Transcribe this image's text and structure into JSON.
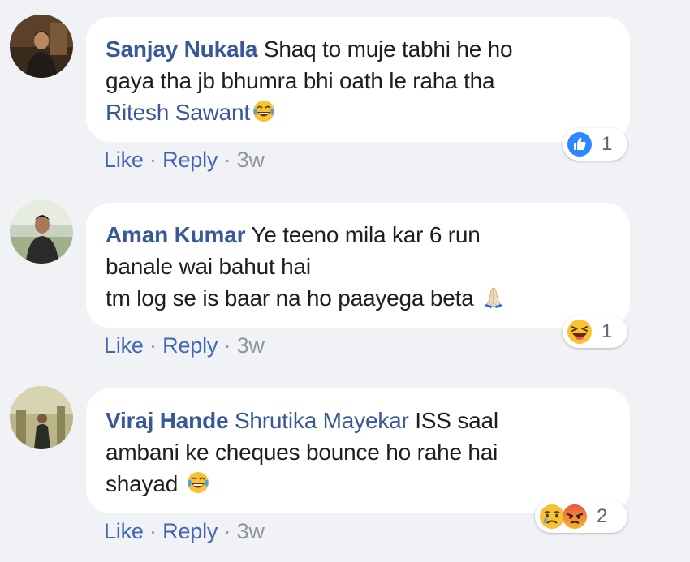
{
  "comments": [
    {
      "author": "Sanjay Nukala",
      "text_line1": " Shaq to muje tabhi he ho",
      "text_line2": "gaya tha jb bhumra bhi oath le raha tha",
      "tag": "Ritesh Sawant",
      "emoji": "tears-of-joy-emoji",
      "actions": {
        "like": "Like",
        "sep1": " · ",
        "reply": "Reply",
        "sep2": " · ",
        "time": "3w"
      },
      "reactions": {
        "icons": [
          "like-reaction-icon"
        ],
        "count": "1"
      }
    },
    {
      "author": "Aman Kumar",
      "text_line1": " Ye teeno mila kar 6 run",
      "text_line2": "banale wai bahut hai",
      "text_line3": "tm log se is baar na ho paayega beta ",
      "emoji": "folded-hands-emoji",
      "actions": {
        "like": "Like",
        "sep1": " · ",
        "reply": "Reply",
        "sep2": " · ",
        "time": "3w"
      },
      "reactions": {
        "icons": [
          "haha-reaction-icon"
        ],
        "count": "1"
      }
    },
    {
      "author": "Viraj Hande",
      "tag": "Shrutika Mayekar",
      "text_line1": " ISS saal",
      "text_line2": "ambani ke cheques bounce ho rahe hai",
      "text_line3": "shayad ",
      "emoji": "tears-of-joy-emoji",
      "actions": {
        "like": "Like",
        "sep1": " · ",
        "reply": "Reply",
        "sep2": " · ",
        "time": "3w"
      },
      "reactions": {
        "icons": [
          "sad-reaction-icon",
          "angry-reaction-icon"
        ],
        "count": "2"
      }
    }
  ],
  "colors": {
    "background": "#f0f2f5",
    "bubble": "#ffffff",
    "name": "#385898",
    "action_link": "#4267b2",
    "meta": "#90949c"
  }
}
